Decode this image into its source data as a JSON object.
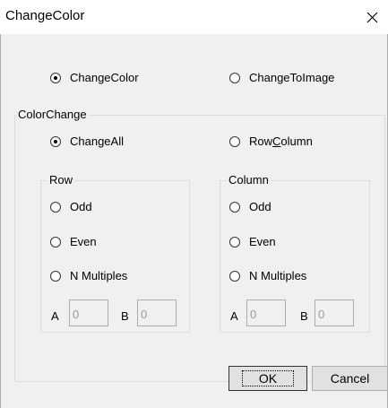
{
  "window": {
    "title": "ChangeColor",
    "close_glyph": "✕"
  },
  "mode": {
    "change_color_label": "ChangeColor",
    "change_to_image_label": "ChangeToImage",
    "selected": "ChangeColor"
  },
  "color_change": {
    "group_label": "ColorChange",
    "change_all_label": "ChangeAll",
    "row_column_prefix": "Row",
    "row_column_mnemonic": "C",
    "row_column_suffix": "olumn",
    "selected": "ChangeAll",
    "row": {
      "group_label": "Row",
      "odd_label": "Odd",
      "even_label": "Even",
      "n_multiples_label": "N Multiples",
      "a_label": "A",
      "a_value": "0",
      "b_label": "B",
      "b_value": "0"
    },
    "column": {
      "group_label": "Column",
      "odd_label": "Odd",
      "even_label": "Even",
      "n_multiples_label": "N Multiples",
      "a_label": "A",
      "a_value": "0",
      "b_label": "B",
      "b_value": "0"
    }
  },
  "buttons": {
    "ok_label": "OK",
    "cancel_label": "Cancel"
  },
  "colors": {
    "dialog_background": "#f0f0f0",
    "titlebar_background": "#ffffff",
    "button_face": "#e1e1e1",
    "border": "#adadad"
  }
}
